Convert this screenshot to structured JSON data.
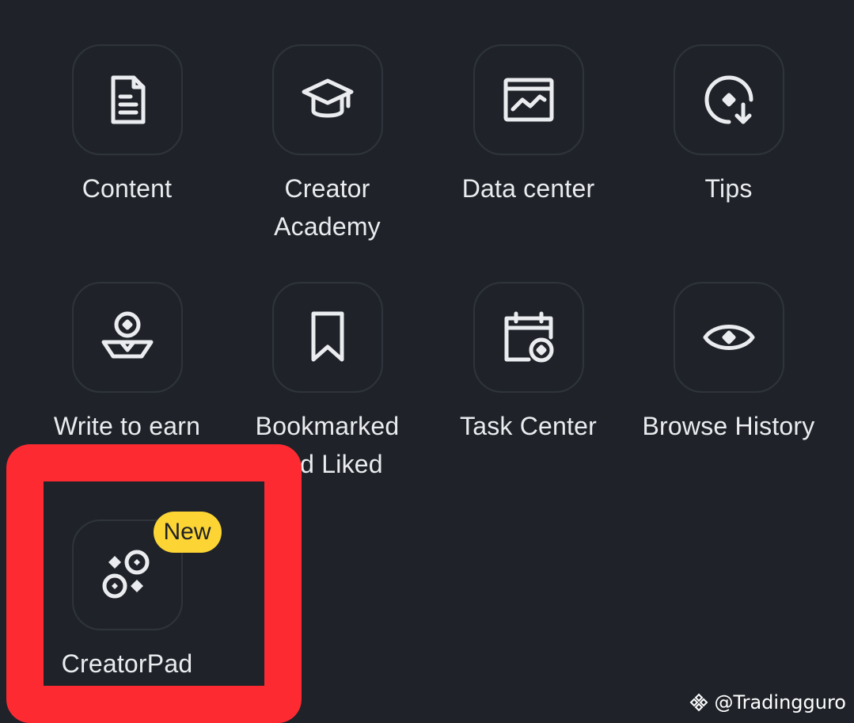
{
  "menu": {
    "items": [
      {
        "label": "Content",
        "icon": "document-icon"
      },
      {
        "label": "Creator\nAcademy",
        "icon": "graduation-cap-icon"
      },
      {
        "label": "Data center",
        "icon": "chart-window-icon"
      },
      {
        "label": "Tips",
        "icon": "tips-download-icon"
      },
      {
        "label": "Write to earn",
        "icon": "write-to-earn-icon"
      },
      {
        "label": "Bookmarked\nand Liked",
        "icon": "bookmark-icon"
      },
      {
        "label": "Task Center",
        "icon": "calendar-task-icon"
      },
      {
        "label": "Browse History",
        "icon": "eye-icon"
      },
      {
        "label": "CreatorPad",
        "icon": "creatorpad-icon",
        "badge": "New"
      }
    ]
  },
  "watermark": {
    "text": "@Tradingguro"
  },
  "colors": {
    "background": "#1f2329",
    "icon_border": "#2f343c",
    "text": "#eaecef",
    "badge": "#fcd535",
    "highlight": "#fe2a32"
  }
}
